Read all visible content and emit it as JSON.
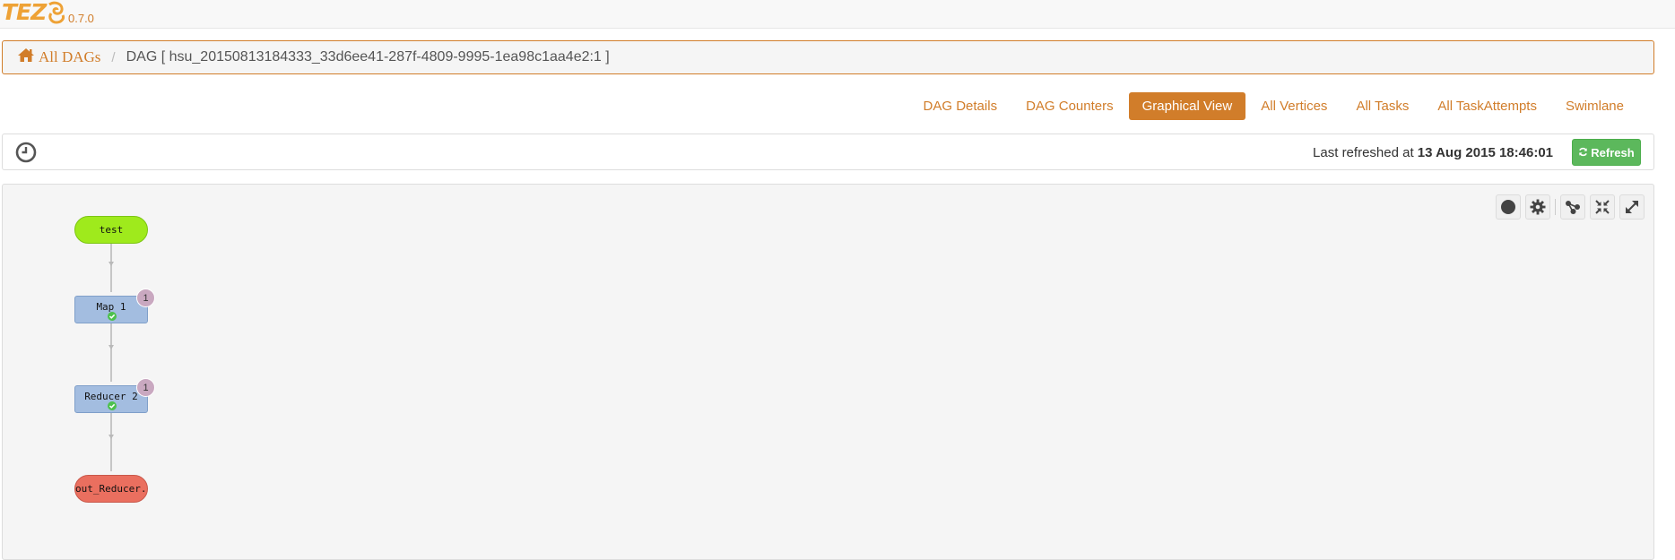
{
  "header": {
    "logo_text": "TEZ",
    "version": "0.7.0"
  },
  "breadcrumb": {
    "home_label": "All DAGs",
    "separator": "/",
    "current": "DAG [ hsu_20150813184333_33d6ee41-287f-4809-9995-1ea98c1aa4e2:1 ]"
  },
  "tabs": [
    {
      "label": "DAG Details",
      "active": false
    },
    {
      "label": "DAG Counters",
      "active": false
    },
    {
      "label": "Graphical View",
      "active": true
    },
    {
      "label": "All Vertices",
      "active": false
    },
    {
      "label": "All Tasks",
      "active": false
    },
    {
      "label": "All TaskAttempts",
      "active": false
    },
    {
      "label": "Swimlane",
      "active": false
    }
  ],
  "status": {
    "refreshed_prefix": "Last refreshed at",
    "refreshed_time": "13 Aug 2015 18:46:01",
    "refresh_button": "Refresh"
  },
  "graph": {
    "toolbar_icons": [
      "record-icon",
      "gear-icon",
      "share-icon",
      "collapse-icon",
      "expand-icon"
    ],
    "nodes": [
      {
        "id": "test",
        "label": "test",
        "kind": "input"
      },
      {
        "id": "map1",
        "label": "Map 1",
        "kind": "vertex",
        "badge": "1",
        "status": "succeeded"
      },
      {
        "id": "reducer2",
        "label": "Reducer 2",
        "kind": "vertex",
        "badge": "1",
        "status": "succeeded"
      },
      {
        "id": "out",
        "label": "out_Reducer..",
        "kind": "output"
      }
    ]
  },
  "colors": {
    "accent": "#d17d2a",
    "refresh_green": "#5cb85c",
    "input_node": "#9fea1c",
    "vertex_node": "#a3bde0",
    "output_node": "#ea6f5f",
    "badge": "#c9a8c0"
  }
}
